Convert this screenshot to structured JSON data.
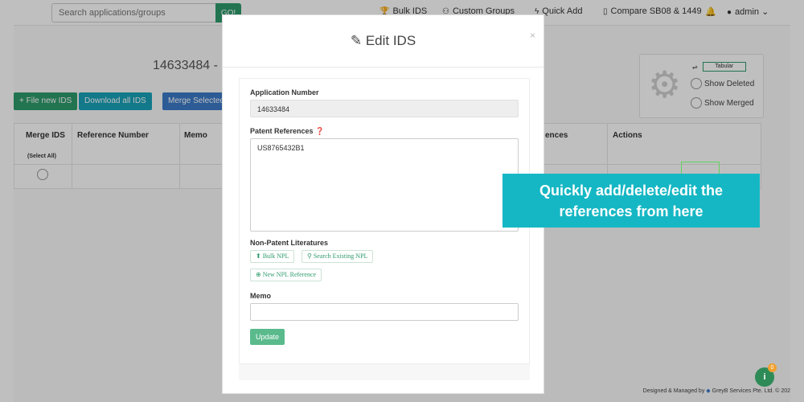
{
  "navbar": {
    "search_placeholder": "Search applications/groups",
    "go_label": "GO!",
    "bulk_ids": "Bulk IDS",
    "custom_groups": "Custom Groups",
    "quick_add": "Quick Add",
    "compare": "Compare SB08 & 1449",
    "user": "admin"
  },
  "page": {
    "title": "14633484 -",
    "buttons": {
      "file_new": "+ File new IDS",
      "download_all": "Download all IDS",
      "merge_selected": "Merge Selected"
    },
    "filters": {
      "toggle_label": "Tabular",
      "show_deleted": "Show Deleted",
      "show_merged": "Show Merged"
    },
    "table": {
      "headers": [
        "Merge IDS",
        "Reference Number",
        "Memo",
        "ences",
        "Actions"
      ],
      "select_all": "(Select All)"
    },
    "footer": {
      "designed": "Designed & Managed by",
      "company": "GreyB Services Pte. Ltd. © 202"
    },
    "fab_label": "i",
    "fab_badge": "0"
  },
  "modal": {
    "title": "Edit IDS",
    "close": "×",
    "application_number_label": "Application Number",
    "application_number_value": "14633484",
    "patent_references_label": "Patent References",
    "patent_references_value": "US8765432B1",
    "npl_label": "Non-Patent Literatures",
    "bulk_npl": "Bulk NPL",
    "search_npl": "Search Existing NPL",
    "new_npl": "New NPL Reference",
    "memo_label": "Memo",
    "memo_value": "",
    "update_label": "Update"
  },
  "tooltip": {
    "line1": "Quickly add/delete/edit the",
    "line2": "references from here"
  },
  "colors": {
    "green": "#2e9b6b",
    "teal": "#16b7c4",
    "blue": "#3b7ac9"
  }
}
